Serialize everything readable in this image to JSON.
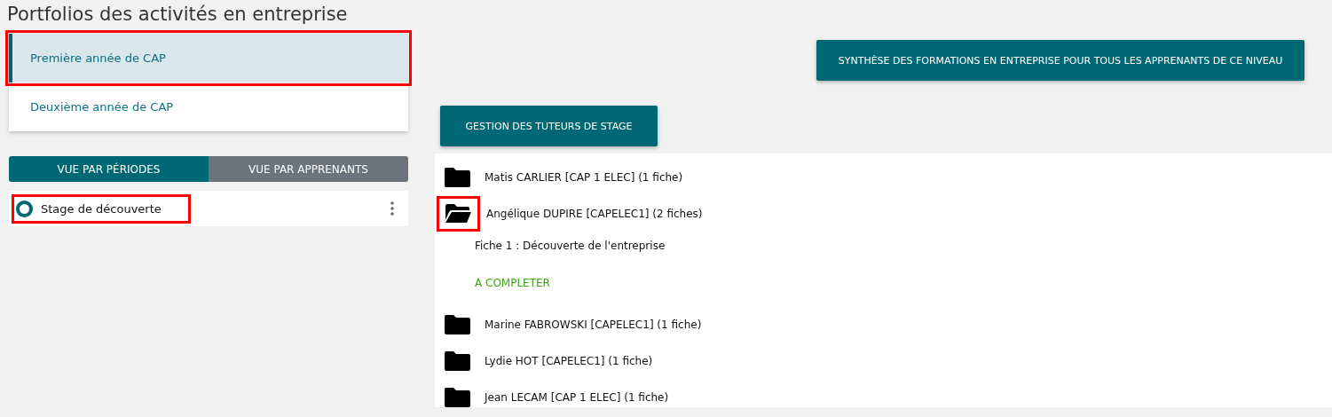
{
  "title": "Portfolios des activités en entreprise",
  "levels": [
    {
      "label": "Première année de CAP",
      "selected": true,
      "highlighted": true
    },
    {
      "label": "Deuxième année de CAP",
      "selected": false,
      "highlighted": false
    }
  ],
  "view_tabs": [
    {
      "label": "VUE PAR PÉRIODES",
      "selected": true
    },
    {
      "label": "VUE PAR APPRENANTS",
      "selected": false
    }
  ],
  "periods": [
    {
      "label": "Stage de découverte",
      "selected": true,
      "highlighted": true
    }
  ],
  "summary_button": "SYNTHÈSE DES FORMATIONS EN ENTREPRISE POUR TOUS LES APPRENANTS DE CE NIVEAU",
  "tutors_button": "GESTION DES TUTEURS DE STAGE",
  "students": [
    {
      "label": "Matis CARLIER [CAP 1 ELEC] (1 fiche)",
      "expanded": false,
      "highlighted": false
    },
    {
      "label": "Angélique DUPIRE [CAPELEC1] (2 fiches)",
      "expanded": true,
      "highlighted": true,
      "children": [
        {
          "label": "Fiche 1 : Découverte de l'entreprise",
          "status": "A COMPLETER"
        }
      ]
    },
    {
      "label": "Marine FABROWSKI [CAPELEC1] (1 fiche)",
      "expanded": false,
      "highlighted": false
    },
    {
      "label": "Lydie HOT [CAPELEC1] (1 fiche)",
      "expanded": false,
      "highlighted": false
    },
    {
      "label": "Jean LECAM [CAP 1 ELEC] (1 fiche)",
      "expanded": false,
      "highlighted": false
    }
  ]
}
